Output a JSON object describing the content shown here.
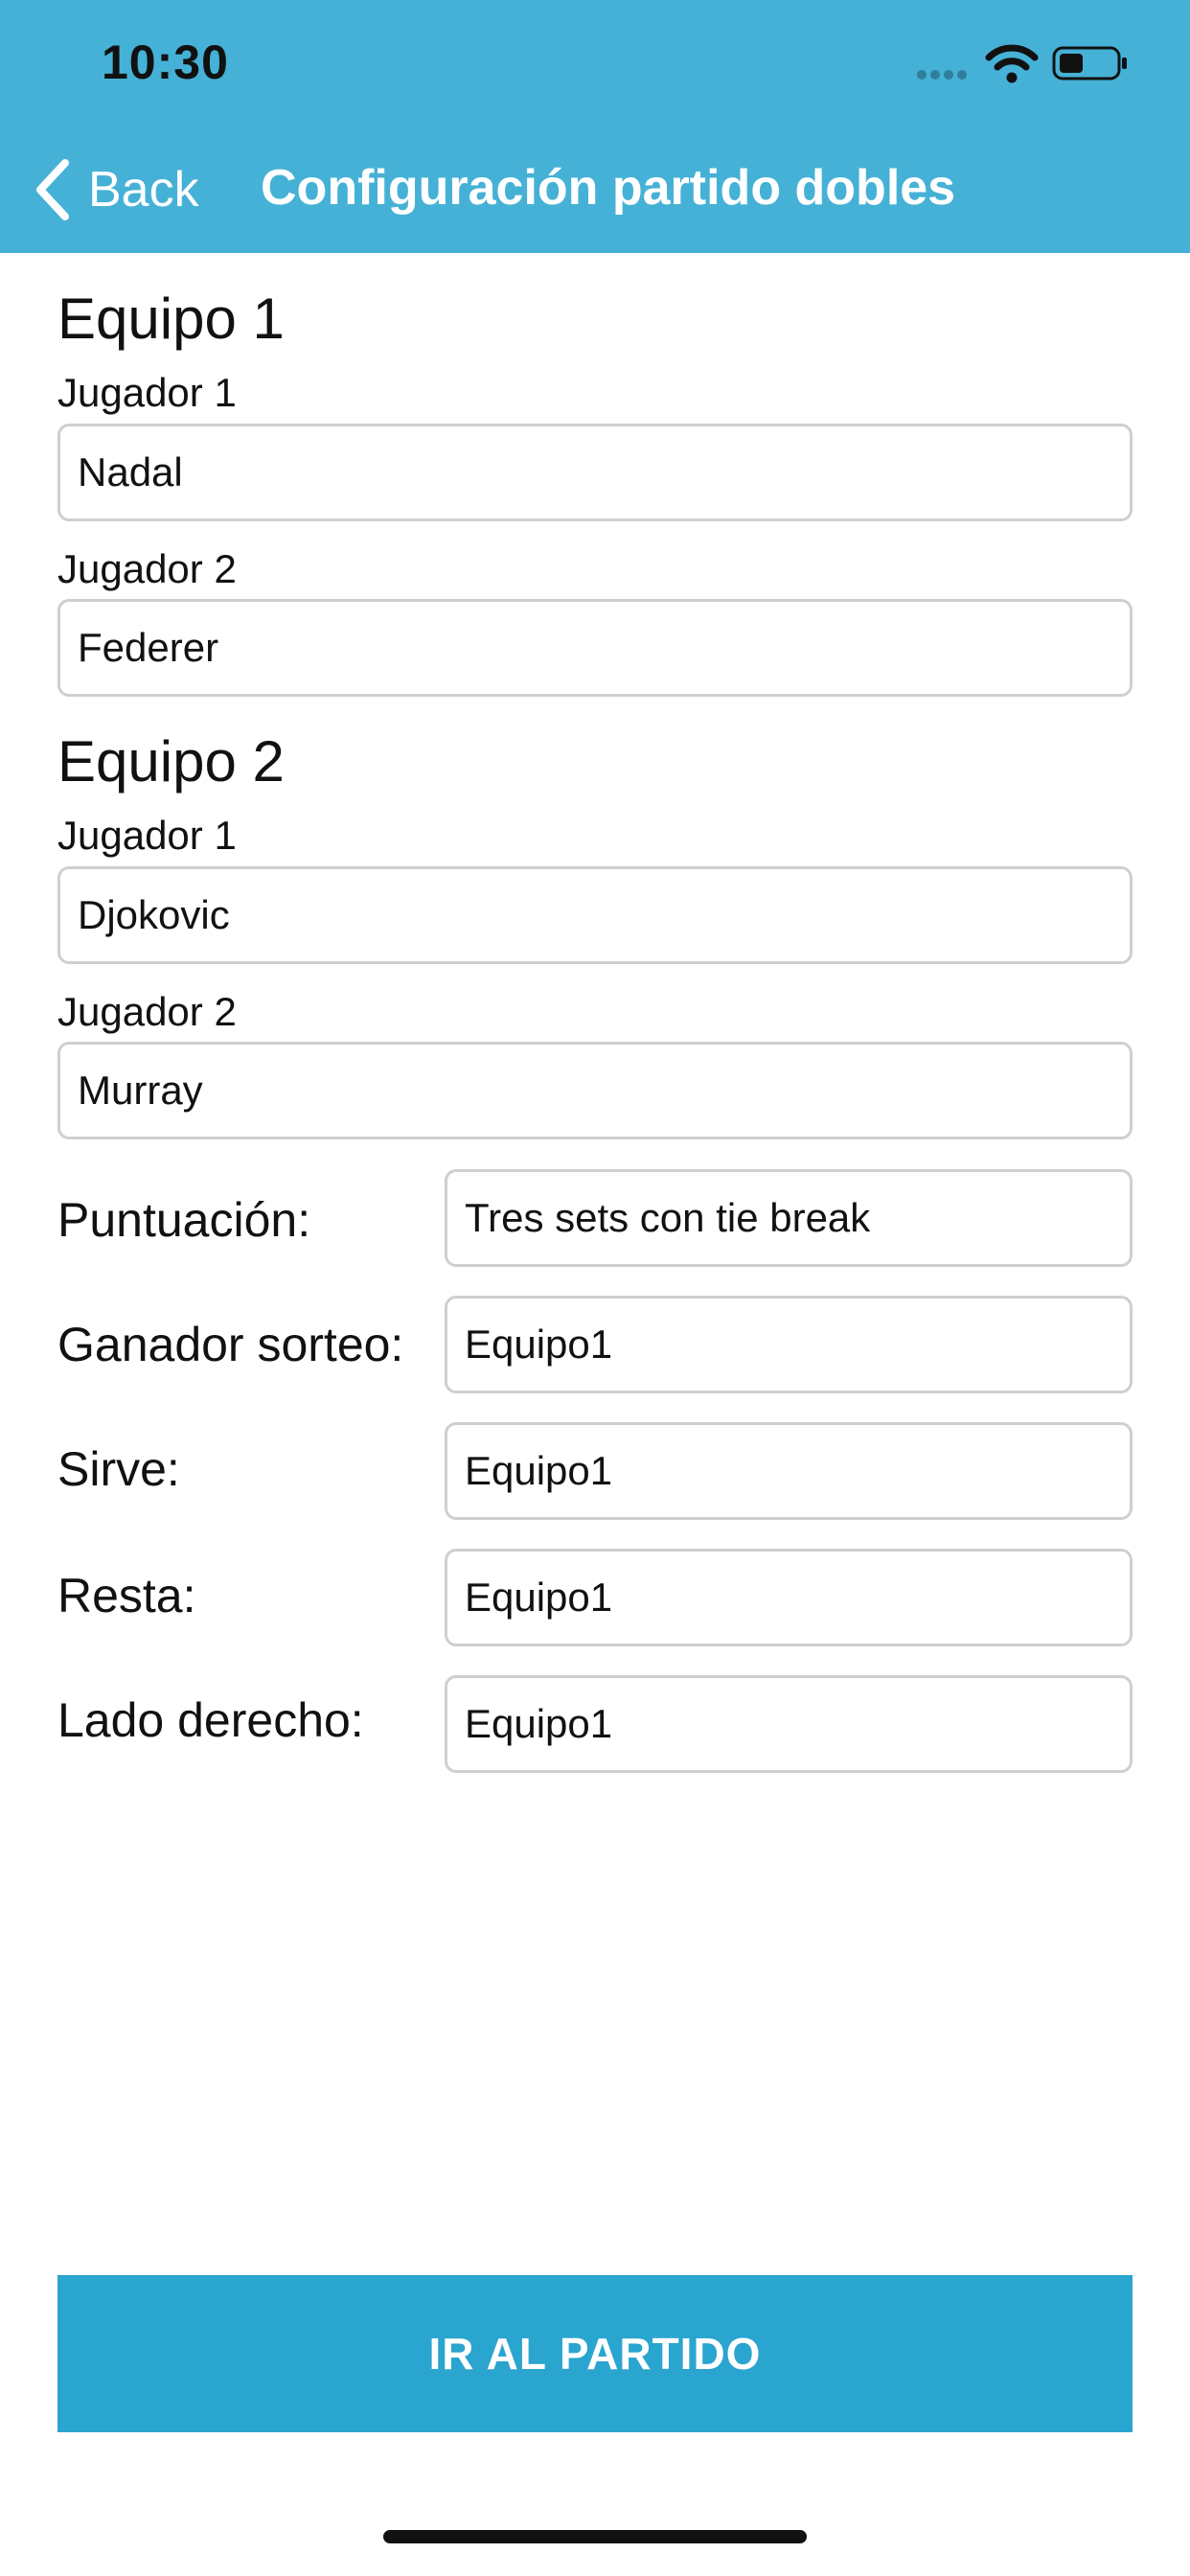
{
  "status_bar": {
    "time": "10:30",
    "icons": [
      "signal-dots-icon",
      "wifi-icon",
      "battery-icon"
    ]
  },
  "nav": {
    "back_label": "Back",
    "title": "Configuración partido dobles",
    "background_color": "#46b1d6"
  },
  "team1": {
    "title": "Equipo 1",
    "player1_label": "Jugador 1",
    "player1_value": "Nadal",
    "player2_label": "Jugador 2",
    "player2_value": "Federer"
  },
  "team2": {
    "title": "Equipo 2",
    "player1_label": "Jugador 1",
    "player1_value": "Djokovic",
    "player2_label": "Jugador 2",
    "player2_value": "Murray"
  },
  "options": {
    "scoring_label": "Puntuación:",
    "scoring_value": "Tres sets con tie break",
    "toss_winner_label": "Ganador sorteo:",
    "toss_winner_value": "Equipo1",
    "serve_label": "Sirve:",
    "serve_value": "Equipo1",
    "receive_label": "Resta:",
    "receive_value": "Equipo1",
    "right_side_label": "Lado derecho:",
    "right_side_value": "Equipo1"
  },
  "action": {
    "go_label": "IR AL PARTIDO",
    "button_color": "#2aa5cf"
  }
}
